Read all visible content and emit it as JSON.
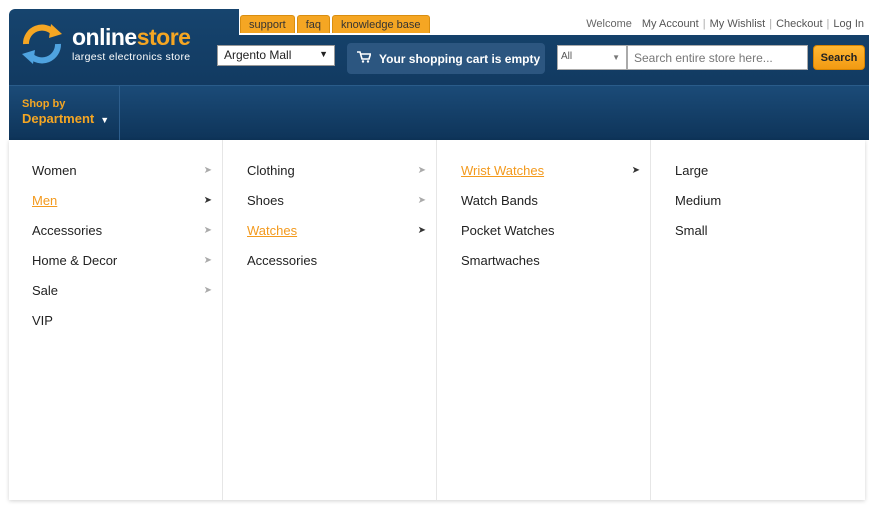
{
  "topnav": {
    "welcome": "Welcome",
    "links": [
      "My Account",
      "My Wishlist",
      "Checkout",
      "Log In"
    ]
  },
  "tabs": [
    "support",
    "faq",
    "knowledge base"
  ],
  "logo": {
    "name_part1": "online",
    "name_part2": "store",
    "tagline": "largest electronics store"
  },
  "mall_select": {
    "value": "Argento Mall"
  },
  "cart": {
    "label": "Your shopping cart is empty"
  },
  "search": {
    "category": "All",
    "placeholder": "Search entire store here...",
    "button": "Search"
  },
  "dept": {
    "line1": "Shop by",
    "line2": "Department"
  },
  "menu": {
    "col1": [
      {
        "label": "Women",
        "arrow": true,
        "active": false
      },
      {
        "label": "Men",
        "arrow": true,
        "active": true
      },
      {
        "label": "Accessories",
        "arrow": true,
        "active": false
      },
      {
        "label": "Home & Decor",
        "arrow": true,
        "active": false
      },
      {
        "label": "Sale",
        "arrow": true,
        "active": false
      },
      {
        "label": "VIP",
        "arrow": false,
        "active": false
      }
    ],
    "col2": [
      {
        "label": "Clothing",
        "arrow": true,
        "active": false
      },
      {
        "label": "Shoes",
        "arrow": true,
        "active": false
      },
      {
        "label": "Watches",
        "arrow": true,
        "active": true
      },
      {
        "label": "Accessories",
        "arrow": false,
        "active": false
      }
    ],
    "col3": [
      {
        "label": "Wrist Watches",
        "arrow": true,
        "active": true
      },
      {
        "label": "Watch Bands",
        "arrow": false,
        "active": false
      },
      {
        "label": "Pocket Watches",
        "arrow": false,
        "active": false
      },
      {
        "label": "Smartwaches",
        "arrow": false,
        "active": false
      }
    ],
    "col4": [
      {
        "label": "Large",
        "arrow": false,
        "active": false
      },
      {
        "label": "Medium",
        "arrow": false,
        "active": false
      },
      {
        "label": "Small",
        "arrow": false,
        "active": false
      }
    ]
  },
  "colors": {
    "accent": "#f5a623",
    "header": "#16446e",
    "link_active": "#f39a1e"
  }
}
